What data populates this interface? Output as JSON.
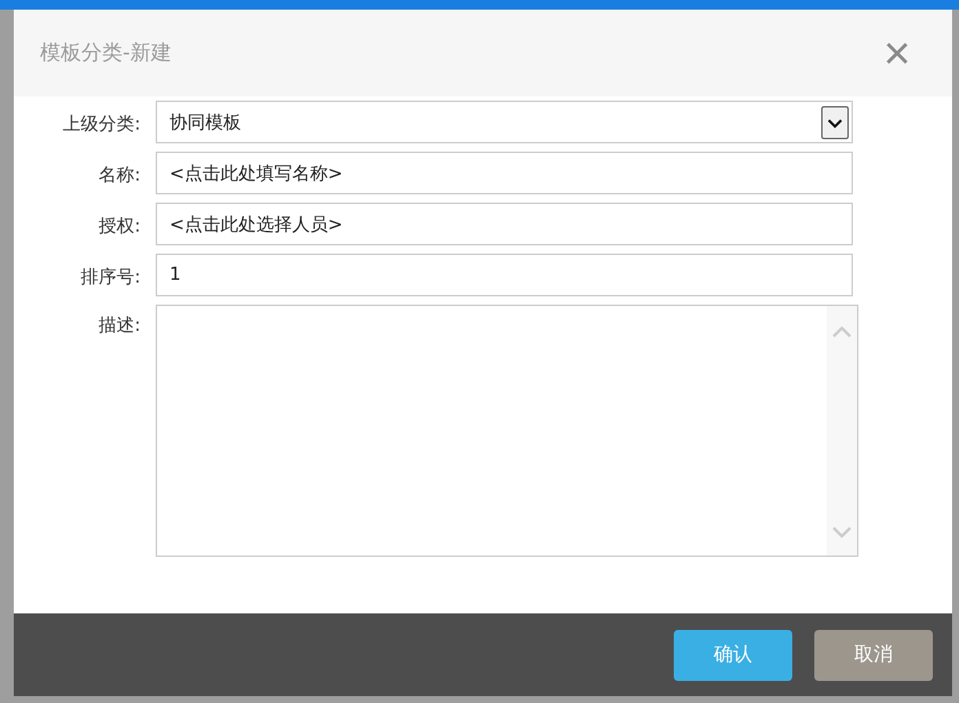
{
  "dialog": {
    "title": "模板分类-新建",
    "close": "×"
  },
  "fields": [
    {
      "kind": "select",
      "label": "上级分类:",
      "value": "协同模板"
    },
    {
      "kind": "text",
      "label": "名称:",
      "value": "<点击此处填写名称>"
    },
    {
      "kind": "text",
      "label": "授权:",
      "value": "<点击此处选择人员>"
    },
    {
      "kind": "text",
      "label": "排序号:",
      "value": "1"
    },
    {
      "kind": "textarea",
      "label": "描述:"
    }
  ],
  "buttons": [
    {
      "label": "确认",
      "kind": "primary"
    },
    {
      "label": "取消",
      "kind": "secondary"
    }
  ]
}
